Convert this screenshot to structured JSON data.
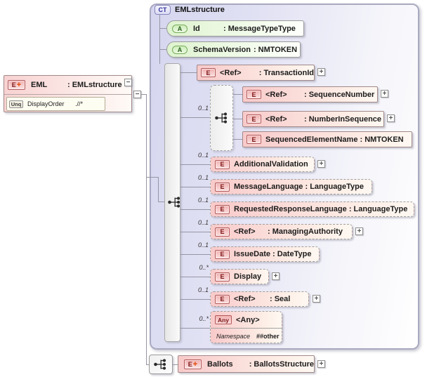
{
  "eml_element": {
    "badge": "E",
    "badge_plus": "+",
    "name": "EML",
    "type": ": EMLstructure",
    "collapse": "−",
    "constraint": {
      "badge": "Unq",
      "name": "DisplayOrder",
      "selector": ".//*"
    }
  },
  "connector_collapse": "−",
  "complex_type": {
    "badge": "CT",
    "title": "EMLstructure",
    "attributes": [
      {
        "badge": "A",
        "name": "Id",
        "type": ": MessageTypeType"
      },
      {
        "badge": "A",
        "name": "SchemaVersion",
        "type": ": NMTOKEN"
      }
    ],
    "children": [
      {
        "badge": "E",
        "name": "<Ref>",
        "type": ": TransactionId",
        "occurs": "",
        "expand": "+"
      },
      {
        "occurs": "0..1",
        "group": "sequence",
        "children": [
          {
            "badge": "E",
            "name": "<Ref>",
            "type": ": SequenceNumber",
            "expand": "+"
          },
          {
            "badge": "E",
            "name": "<Ref>",
            "type": ": NumberInSequence",
            "expand": "+"
          },
          {
            "badge": "E",
            "name": "SequencedElementName : NMTOKEN"
          }
        ]
      },
      {
        "badge": "E",
        "name": "AdditionalValidation",
        "occurs": "0..1",
        "expand": "+"
      },
      {
        "badge": "E",
        "name": "MessageLanguage : LanguageType",
        "occurs": "0..1"
      },
      {
        "badge": "E",
        "name": "RequestedResponseLanguage : LanguageType",
        "occurs": "0..1"
      },
      {
        "badge": "E",
        "name": "<Ref>",
        "type": ": ManagingAuthority",
        "occurs": "0..1",
        "expand": "+"
      },
      {
        "badge": "E",
        "name": "IssueDate : DateType",
        "occurs": "0..1"
      },
      {
        "badge": "E",
        "name": "Display",
        "occurs": "0..*",
        "expand": "+"
      },
      {
        "badge": "E",
        "name": "<Ref>",
        "type": ": Seal",
        "occurs": "0..1",
        "expand": "+"
      },
      {
        "badge": "Any",
        "name": "<Any>",
        "occurs": "0..*",
        "ns_label": "Namespace",
        "ns_value": "##other"
      }
    ]
  },
  "ballots": {
    "badge": "E",
    "badge_plus": "+",
    "name": "Ballots",
    "type": ": BallotsStructure",
    "expand": "+"
  }
}
